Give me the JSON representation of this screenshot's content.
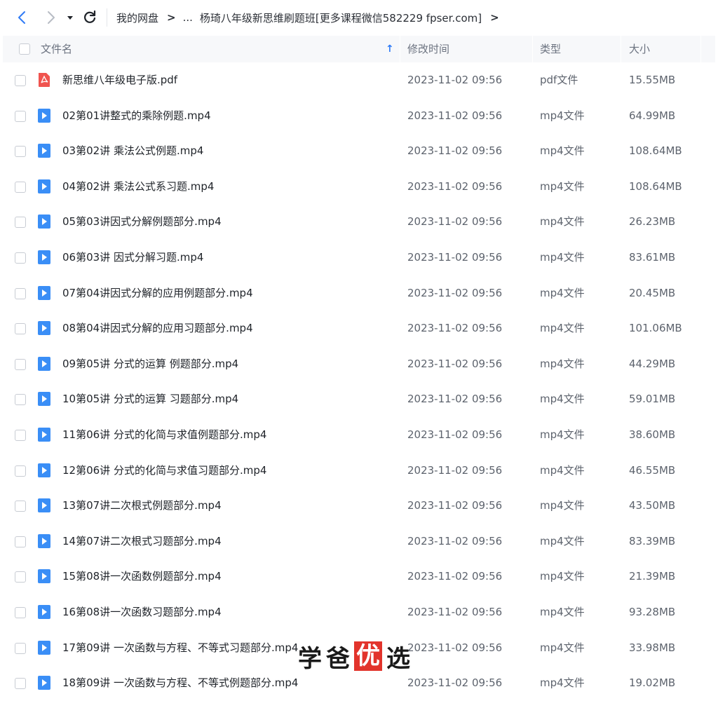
{
  "toolbar": {
    "breadcrumb": {
      "root": "我的网盘",
      "ellipsis": "...",
      "current": "杨琦八年级新思维刷题班[更多课程微信582229 fpser.com]"
    }
  },
  "header": {
    "name": "文件名",
    "modified": "修改时间",
    "type": "类型",
    "size": "大小"
  },
  "colors": {
    "accent": "#2f7bf6",
    "pdf_icon": "#f0544f",
    "video_icon": "#3a8ef6"
  },
  "files": [
    {
      "name": "新思维八年级电子版.pdf",
      "time": "2023-11-02 09:56",
      "type": "pdf文件",
      "size": "15.55MB",
      "icon": "pdf-icon"
    },
    {
      "name": "02第01讲整式的乘除例题.mp4",
      "time": "2023-11-02 09:56",
      "type": "mp4文件",
      "size": "64.99MB",
      "icon": "video-icon"
    },
    {
      "name": "03第02讲 乘法公式例题.mp4",
      "time": "2023-11-02 09:56",
      "type": "mp4文件",
      "size": "108.64MB",
      "icon": "video-icon"
    },
    {
      "name": "04第02讲 乘法公式系习题.mp4",
      "time": "2023-11-02 09:56",
      "type": "mp4文件",
      "size": "108.64MB",
      "icon": "video-icon"
    },
    {
      "name": "05第03讲因式分解例题部分.mp4",
      "time": "2023-11-02 09:56",
      "type": "mp4文件",
      "size": "26.23MB",
      "icon": "video-icon"
    },
    {
      "name": "06第03讲 因式分解习题.mp4",
      "time": "2023-11-02 09:56",
      "type": "mp4文件",
      "size": "83.61MB",
      "icon": "video-icon"
    },
    {
      "name": "07第04讲因式分解的应用例题部分.mp4",
      "time": "2023-11-02 09:56",
      "type": "mp4文件",
      "size": "20.45MB",
      "icon": "video-icon"
    },
    {
      "name": "08第04讲因式分解的应用习题部分.mp4",
      "time": "2023-11-02 09:56",
      "type": "mp4文件",
      "size": "101.06MB",
      "icon": "video-icon"
    },
    {
      "name": "09第05讲 分式的运算 例题部分.mp4",
      "time": "2023-11-02 09:56",
      "type": "mp4文件",
      "size": "44.29MB",
      "icon": "video-icon"
    },
    {
      "name": "10第05讲 分式的运算 习题部分.mp4",
      "time": "2023-11-02 09:56",
      "type": "mp4文件",
      "size": "59.01MB",
      "icon": "video-icon"
    },
    {
      "name": "11第06讲 分式的化简与求值例题部分.mp4",
      "time": "2023-11-02 09:56",
      "type": "mp4文件",
      "size": "38.60MB",
      "icon": "video-icon"
    },
    {
      "name": "12第06讲 分式的化简与求值习题部分.mp4",
      "time": "2023-11-02 09:56",
      "type": "mp4文件",
      "size": "46.55MB",
      "icon": "video-icon"
    },
    {
      "name": "13第07讲二次根式例题部分.mp4",
      "time": "2023-11-02 09:56",
      "type": "mp4文件",
      "size": "43.50MB",
      "icon": "video-icon"
    },
    {
      "name": "14第07讲二次根式习题部分.mp4",
      "time": "2023-11-02 09:56",
      "type": "mp4文件",
      "size": "83.39MB",
      "icon": "video-icon"
    },
    {
      "name": "15第08讲一次函数例题部分.mp4",
      "time": "2023-11-02 09:56",
      "type": "mp4文件",
      "size": "21.39MB",
      "icon": "video-icon"
    },
    {
      "name": "16第08讲一次函数习题部分.mp4",
      "time": "2023-11-02 09:56",
      "type": "mp4文件",
      "size": "93.28MB",
      "icon": "video-icon"
    },
    {
      "name": "17第09讲 一次函数与方程、不等式习题部分.mp4",
      "time": "2023-11-02 09:56",
      "type": "mp4文件",
      "size": "33.98MB",
      "icon": "video-icon"
    },
    {
      "name": "18第09讲 一次函数与方程、不等式例题部分.mp4",
      "time": "2023-11-02 09:56",
      "type": "mp4文件",
      "size": "19.02MB",
      "icon": "video-icon"
    }
  ],
  "watermark": {
    "part1": "学爸",
    "boxed": "优",
    "part2": "选"
  }
}
